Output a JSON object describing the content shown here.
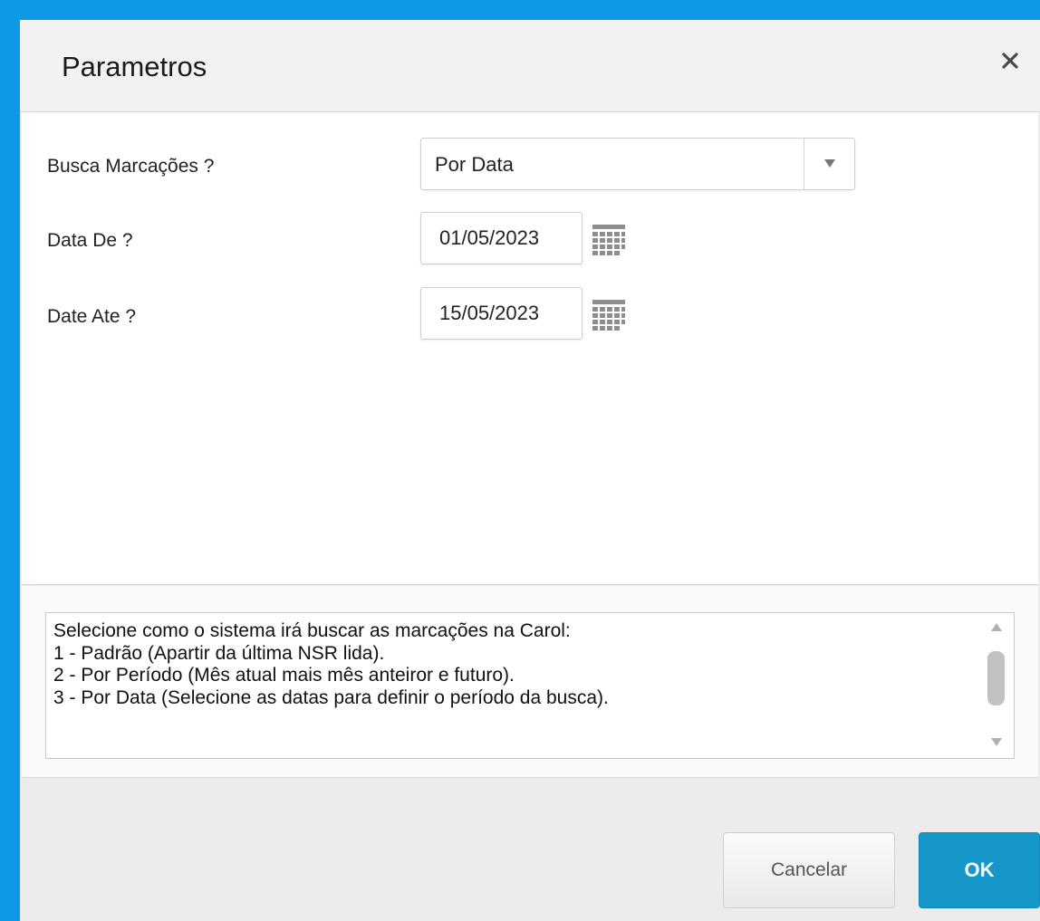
{
  "dialog": {
    "title": "Parametros",
    "close_icon": "close-icon"
  },
  "params": [
    {
      "label": "Busca Marcações ?",
      "type": "select",
      "value": "Por Data"
    },
    {
      "label": "Data De ?",
      "type": "date",
      "value": "01/05/2023",
      "icon": "calendar-icon"
    },
    {
      "label": "Date Ate ?",
      "type": "date",
      "value": "15/05/2023",
      "icon": "calendar-icon"
    }
  ],
  "help": {
    "lines": [
      "Selecione como o sistema irá buscar as marcações na Carol:",
      "1 - Padrão (Apartir da última NSR lida).",
      "2 - Por Período (Mês atual mais mês anteiror e futuro).",
      "3 - Por Data (Selecione as datas para definir o período da busca)."
    ]
  },
  "footer": {
    "cancel_label": "Cancelar",
    "ok_label": "OK"
  },
  "colors": {
    "background": "#0e99e6",
    "ok_button": "#1697c9"
  }
}
